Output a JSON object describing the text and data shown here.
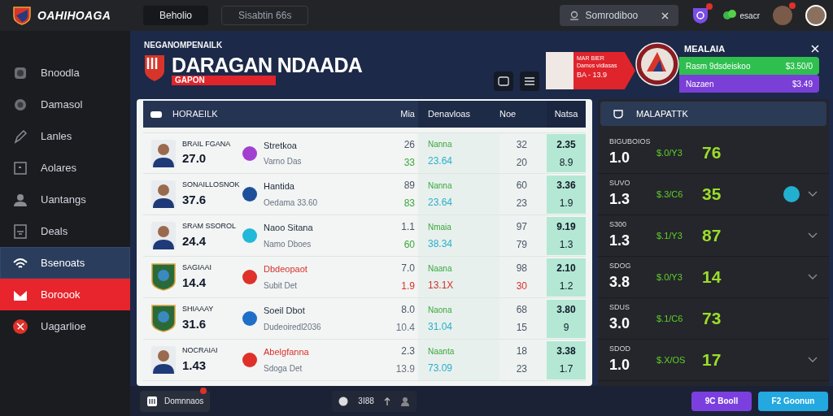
{
  "brand": {
    "name": "OAHIHOAGA"
  },
  "top_tabs": [
    {
      "label": "Beholio",
      "selected": true
    },
    {
      "label": "Sisabtin 66s",
      "selected": false
    }
  ],
  "search": {
    "value": "Somrodiboo"
  },
  "top_icons": {
    "wallet_label": "esacr"
  },
  "sidebar": {
    "items": [
      {
        "label": "Bnoodla",
        "selected": false,
        "highlighted": false
      },
      {
        "label": "Damasol",
        "selected": false,
        "highlighted": false
      },
      {
        "label": "Lanles",
        "selected": false,
        "highlighted": false
      },
      {
        "label": "Aolares",
        "selected": false,
        "highlighted": false
      },
      {
        "label": "Uantangs",
        "selected": false,
        "highlighted": false
      },
      {
        "label": "Deals",
        "selected": false,
        "highlighted": false
      },
      {
        "label": "Bsenoats",
        "selected": false,
        "highlighted": true
      },
      {
        "label": "Boroook",
        "selected": true,
        "highlighted": false
      },
      {
        "label": "Uagarlioe",
        "selected": false,
        "highlighted": false
      }
    ]
  },
  "hero": {
    "kicker": "NEGANOMPENAILK",
    "title": "DARAGAN NDAADA",
    "subtitle": "GAPON",
    "player_card": {
      "name": "MAR BIER",
      "detail": "Damos vidiasas",
      "score": "BA - 13.9"
    },
    "promo": {
      "title": "MEALAIA",
      "rows": [
        {
          "label": "Rasm 9dsdeiskoo",
          "value": "$3.50/0",
          "color": "#2fbf4f"
        },
        {
          "label": "Nazaen",
          "value": "$3.49",
          "color": "#7a3fd6"
        }
      ]
    }
  },
  "table": {
    "columns": [
      "HORAEILK",
      "Mia",
      "Denavloas",
      "Noe",
      "Natsa"
    ],
    "rows": [
      {
        "name": "BRAIL FGANA",
        "score": "27.0",
        "kind": "person",
        "color": "#a23fd0",
        "team": "Stretkoa",
        "team_sub": "Varno Das",
        "flagged": false,
        "rising": true,
        "falling": false,
        "v1": "26",
        "v2": "33",
        "status": "Nanna",
        "amount": "23.64",
        "v3": "32",
        "v4": "20",
        "h1": "2.35",
        "h2": "8.9"
      },
      {
        "name": "SONAILLOSNOK",
        "score": "37.6",
        "kind": "person",
        "color": "#1e4f9a",
        "team": "Hantida",
        "team_sub": "Oedama 33.60",
        "flagged": false,
        "rising": true,
        "falling": false,
        "v1": "89",
        "v2": "83",
        "status": "Nanna",
        "amount": "23.64",
        "v3": "60",
        "v4": "23",
        "h1": "3.36",
        "h2": "1.9"
      },
      {
        "name": "SRAM SSOROL",
        "score": "24.4",
        "kind": "person",
        "color": "#22b8d8",
        "team": "Naoo Sitana",
        "team_sub": "Namo Dboes",
        "flagged": false,
        "rising": true,
        "falling": false,
        "v1": "1.1",
        "v2": "60",
        "status": "Nmaia",
        "amount": "38.34",
        "v3": "97",
        "v4": "79",
        "h1": "9.19",
        "h2": "1.3"
      },
      {
        "name": "SAGIAAI",
        "score": "14.4",
        "kind": "crest",
        "color": "#e0302a",
        "team": "Dbdeopaot",
        "team_sub": "Subit Det",
        "flagged": true,
        "rising": false,
        "falling": true,
        "v1": "7.0",
        "v2": "1.9",
        "status": "Naana",
        "amount": "13.1X",
        "v3": "98",
        "v4": "30",
        "h1": "2.10",
        "h2": "1.2"
      },
      {
        "name": "SHIAAAY",
        "score": "31.6",
        "kind": "crest",
        "color": "#1e6fc8",
        "team": "Soeil Dbot",
        "team_sub": "Dudeoiredl2036",
        "flagged": false,
        "rising": false,
        "falling": false,
        "v1": "8.0",
        "v2": "10.4",
        "status": "Naona",
        "amount": "31.04",
        "v3": "68",
        "v4": "15",
        "h1": "3.80",
        "h2": "9"
      },
      {
        "name": "NOCRAIAI",
        "score": "1.43",
        "kind": "person",
        "color": "#e0302a",
        "team": "Abelgfanna",
        "team_sub": "Sdoga Det",
        "flagged": true,
        "rising": false,
        "falling": false,
        "v1": "2.3",
        "v2": "13.9",
        "status": "Naanta",
        "amount": "73.09",
        "v3": "18",
        "v4": "23",
        "h1": "3.38",
        "h2": "1.7"
      }
    ]
  },
  "side_panel": {
    "title": "MALAPATTK",
    "rows": [
      {
        "label": "BIGUBOIOS",
        "value": "1.0",
        "change": "$.0/Y3",
        "big": "76",
        "badge": false,
        "expandable": false
      },
      {
        "label": "SUVO",
        "value": "1.3",
        "change": "$.3/C6",
        "big": "35",
        "badge": true,
        "expandable": true
      },
      {
        "label": "S300",
        "value": "1.3",
        "change": "$.1/Y3",
        "big": "87",
        "badge": false,
        "expandable": true
      },
      {
        "label": "SDOG",
        "value": "3.8",
        "change": "$.0/Y3",
        "big": "14",
        "badge": false,
        "expandable": true
      },
      {
        "label": "SDUS",
        "value": "3.0",
        "change": "$.1/C6",
        "big": "73",
        "badge": false,
        "expandable": false
      },
      {
        "label": "SDOD",
        "value": "1.0",
        "change": "$.X/OS",
        "big": "17",
        "badge": false,
        "expandable": true
      }
    ]
  },
  "bottom_bar": {
    "left_button": "Domnnaos",
    "center_count": "3I88",
    "actions": [
      {
        "label": "9C Booll",
        "kind": "purple"
      },
      {
        "label": "F2 Goonun",
        "kind": "cyan"
      }
    ]
  }
}
